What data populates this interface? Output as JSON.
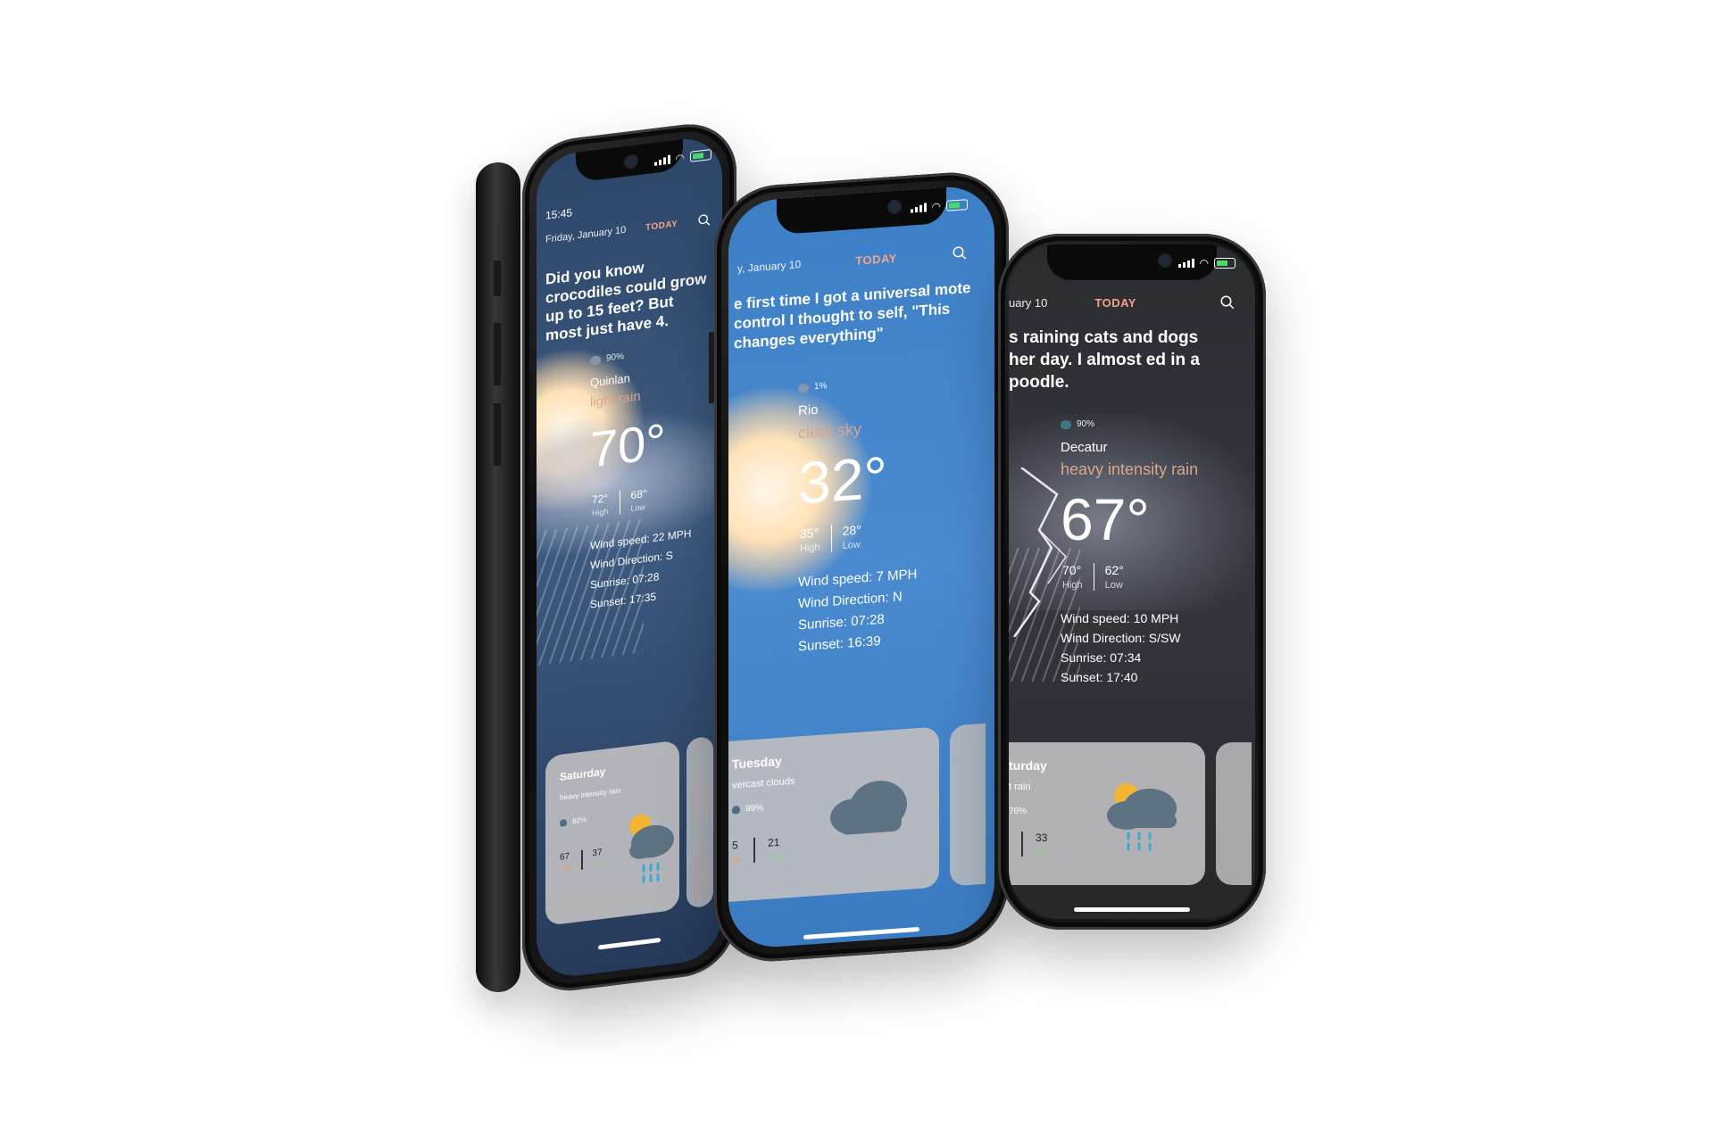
{
  "phones": [
    {
      "status_time": "15:45",
      "date": "Friday, January 10",
      "tab": "TODAY",
      "joke": "Did you know crocodiles could grow up to 15 feet? But most just have 4.",
      "precip": "90%",
      "city": "Quinlan",
      "description": "light rain",
      "temp": "70°",
      "high": "72°",
      "high_label": "High",
      "low": "68°",
      "low_label": "Low",
      "wind_speed": "Wind speed: 22 MPH",
      "wind_direction": "Wind Direction: S",
      "sunrise": "Sunrise: 07:28",
      "sunset": "Sunset: 17:35",
      "card": {
        "day": "Saturday",
        "description": "heavy intensity rain",
        "precip": "82%",
        "high": "67",
        "high_label": "High",
        "low": "37",
        "low_label": "Low",
        "icon": "sun-cloud-rain-icon"
      }
    },
    {
      "date": "y, January 10",
      "tab": "TODAY",
      "joke": "e first time I got a universal mote control I thought to self, \"This changes everything\"",
      "precip": "1%",
      "city": "Rio",
      "description": "clear sky",
      "temp": "32°",
      "high": "35°",
      "high_label": "High",
      "low": "28°",
      "low_label": "Low",
      "wind_speed": "Wind speed: 7 MPH",
      "wind_direction": "Wind Direction: N",
      "sunrise": "Sunrise: 07:28",
      "sunset": "Sunset: 16:39",
      "card": {
        "day": "Tuesday",
        "description": "vercast clouds",
        "precip": "99%",
        "high": "5",
        "high_label": "gh",
        "low": "21",
        "low_label": "Low",
        "icon": "cloud-icon"
      }
    },
    {
      "date": "uary 10",
      "tab": "TODAY",
      "joke": "s raining cats and dogs her day. I almost ed in a poodle.",
      "precip": "90%",
      "city": "Decatur",
      "description": "heavy intensity rain",
      "temp": "67°",
      "high": "70°",
      "high_label": "High",
      "low": "62°",
      "low_label": "Low",
      "wind_speed": "Wind speed: 10 MPH",
      "wind_direction": "Wind Direction: S/SW",
      "sunrise": "Sunrise: 07:34",
      "sunset": "Sunset: 17:40",
      "card": {
        "day": "turday",
        "description": "t rain",
        "precip": "76%",
        "high": "",
        "high_label": "",
        "low": "33",
        "low_label": "Low",
        "icon": "sun-cloud-rain-icon"
      }
    }
  ],
  "colors": {
    "phone1_bg": "#2e4a6e",
    "phone2_bg": "#3a7cc3",
    "phone3_bg": "#2b2d31",
    "accent": "#f2a38a",
    "desc_color": "#d9a78e"
  }
}
